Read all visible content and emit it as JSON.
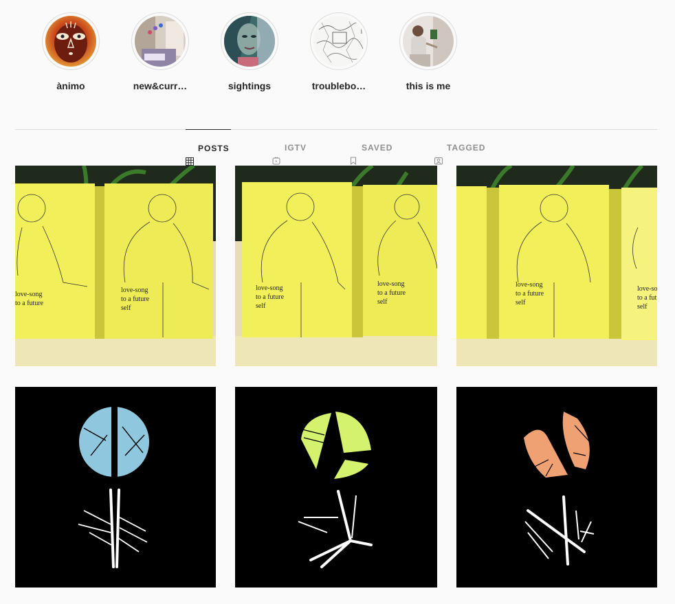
{
  "highlights": [
    {
      "label": "ànimo",
      "icon": "face-mask-illustration"
    },
    {
      "label": "new&curr…",
      "icon": "studio-room-photo"
    },
    {
      "label": "sightings",
      "icon": "painted-face-artwork"
    },
    {
      "label": "troublebo…",
      "icon": "sketch-map-drawing"
    },
    {
      "label": "this is me",
      "icon": "person-portrait-photo"
    }
  ],
  "tabs": [
    {
      "label": "POSTS",
      "icon": "grid-icon",
      "active": true
    },
    {
      "label": "IGTV",
      "icon": "igtv-icon",
      "active": false
    },
    {
      "label": "SAVED",
      "icon": "bookmark-icon",
      "active": false
    },
    {
      "label": "TAGGED",
      "icon": "tag-person-icon",
      "active": false
    }
  ],
  "posts": [
    {
      "type": "zine",
      "caption": [
        "love-song",
        "to a future",
        "self"
      ]
    },
    {
      "type": "zine",
      "caption": [
        "love-song",
        "to a future",
        "self"
      ]
    },
    {
      "type": "zine",
      "caption": [
        "love-song",
        "to a future",
        "self"
      ]
    },
    {
      "type": "flower",
      "color": "#8fc8de"
    },
    {
      "type": "flower",
      "color": "#d4f26e"
    },
    {
      "type": "flower",
      "color": "#f0a174"
    }
  ],
  "colors": {
    "background": "#fafafa",
    "border": "#dbdbdb",
    "text": "#262626",
    "muted": "#8e8e8e",
    "zine_yellow": "#f2f05a"
  }
}
